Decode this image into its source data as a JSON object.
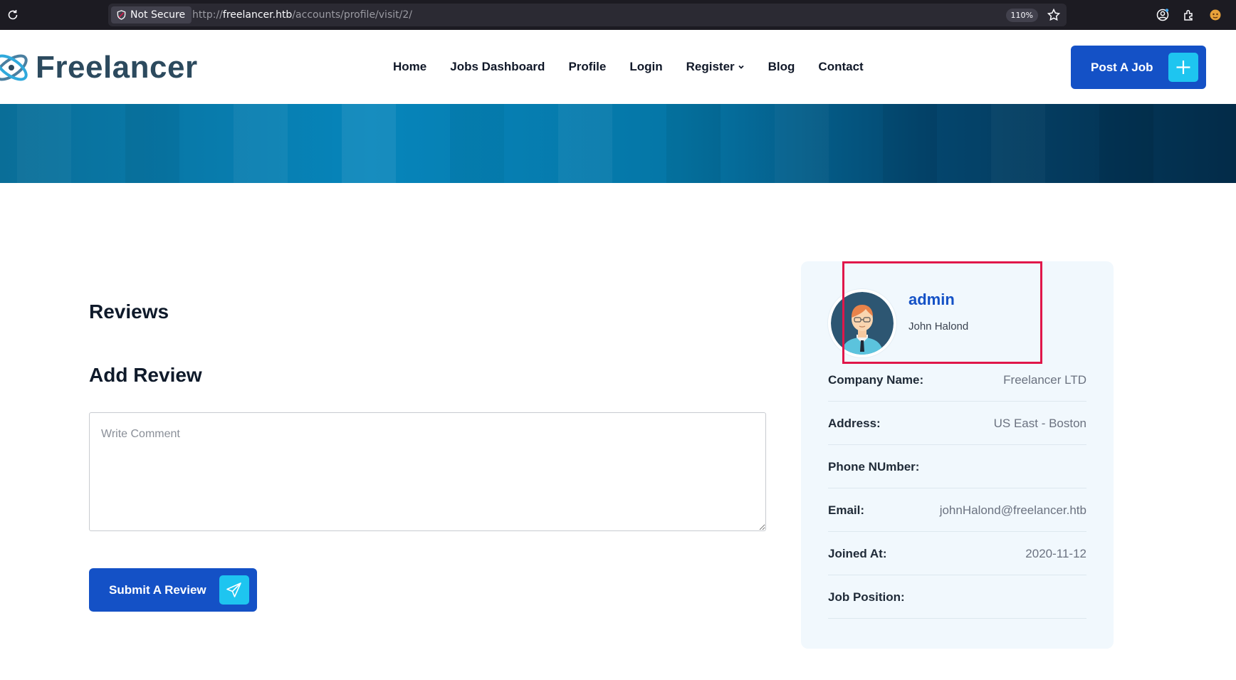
{
  "browser": {
    "security_label": "Not Secure",
    "url_prefix": "http://",
    "url_host": "freelancer.htb",
    "url_path": "/accounts/profile/visit/2/",
    "zoom": "110%"
  },
  "header": {
    "logo_text": "Freelancer",
    "nav": [
      "Home",
      "Jobs Dashboard",
      "Profile",
      "Login",
      "Register",
      "Blog",
      "Contact"
    ],
    "post_job_label": "Post A Job"
  },
  "content": {
    "reviews_title": "Reviews",
    "add_review_title": "Add Review",
    "comment_placeholder": "Write Comment",
    "submit_label": "Submit A Review"
  },
  "profile": {
    "username": "admin",
    "full_name": "John Halond",
    "fields": [
      {
        "label": "Company Name:",
        "value": "Freelancer LTD"
      },
      {
        "label": "Address:",
        "value": "US East - Boston"
      },
      {
        "label": "Phone NUmber:",
        "value": ""
      },
      {
        "label": "Email:",
        "value": "johnHalond@freelancer.htb"
      },
      {
        "label": "Joined At:",
        "value": "2020-11-12"
      },
      {
        "label": "Job Position:",
        "value": ""
      }
    ]
  },
  "colors": {
    "primary": "#1451c6",
    "accent": "#1ec5f0",
    "highlight": "#e0174a"
  }
}
